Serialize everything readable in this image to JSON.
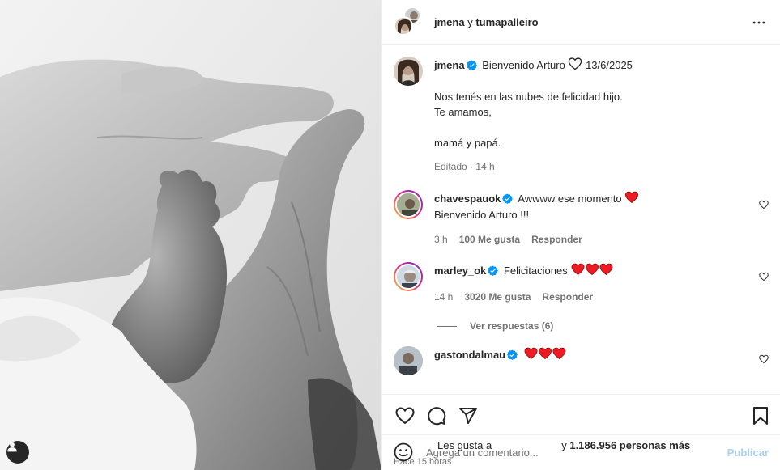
{
  "header": {
    "author": "jmena",
    "connector": "y",
    "coauthor": "tumapalleiro"
  },
  "caption": {
    "username": "jmena",
    "headline": "Bienvenido Arturo",
    "date": "13/6/2025",
    "lines": [
      "Nos tenés en las nubes de felicidad hijo.",
      "Te amamos,",
      "",
      "mamá y papá."
    ],
    "meta": "Editado · 14 h"
  },
  "comments": [
    {
      "username": "chavespauok",
      "text": "Awwww ese momento",
      "text2": "Bienvenido Arturo !!!",
      "time": "3 h",
      "likes": "100 Me gusta",
      "reply": "Responder"
    },
    {
      "username": "marley_ok",
      "text": "Felicitaciones",
      "time": "14 h",
      "likes": "3020 Me gusta",
      "reply": "Responder"
    },
    {
      "username": "gastondalmau",
      "text": ""
    }
  ],
  "view_replies": "Ver respuestas (6)",
  "likes": {
    "prefix": "Les gusta a",
    "connector": "y",
    "count": "1.186.956 personas más"
  },
  "timestamp": "Hace 15 horas",
  "add_comment": {
    "placeholder": "Agrega un comentario...",
    "post_label": "Publicar"
  },
  "colors": {
    "verified": "#0095f6",
    "heart_red": "#ed1c24",
    "post_disabled": "#a8cff8",
    "secondary_text": "#737373"
  },
  "icons": [
    "heart-icon",
    "comment-icon",
    "share-icon",
    "bookmark-icon",
    "emoji-icon",
    "more-icon",
    "user-tag-icon",
    "verified-icon"
  ]
}
